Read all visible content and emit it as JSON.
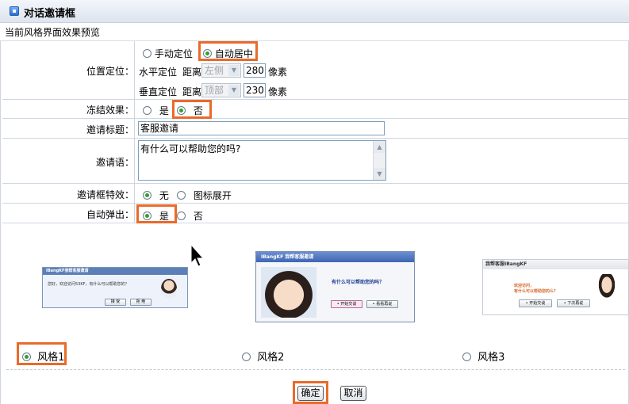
{
  "dialog": {
    "title": "对话邀请框",
    "subtitle": "当前风格界面效果预览"
  },
  "position": {
    "label": "位置定位：",
    "opt_manual": "手动定位",
    "opt_auto": "自动居中",
    "h_label": "水平定位",
    "h_dist": "距离",
    "h_select": "左侧",
    "h_value": "280",
    "h_unit": "像素",
    "v_label": "垂直定位",
    "v_dist": "距离",
    "v_select": "顶部",
    "v_value": "230",
    "v_unit": "像素"
  },
  "freeze": {
    "label": "冻结效果：",
    "opt_yes": "是",
    "opt_no": "否"
  },
  "invite_title": {
    "label": "邀请标题：",
    "value": "客服邀请"
  },
  "invite_text": {
    "label": "邀请语：",
    "value": "有什么可以帮助您的吗?"
  },
  "effect": {
    "label": "邀请框特效：",
    "opt_none": "无",
    "opt_expand": "图标展开"
  },
  "autopop": {
    "label": "自动弹出：",
    "opt_yes": "是",
    "opt_no": "否"
  },
  "styles": {
    "style1": {
      "label": "风格1",
      "header": "IBangKF我帮客服邀请",
      "msg": "您好，欢迎访问53KF，有什么可以帮助您的？",
      "btn_accept": "接 受",
      "btn_reject": "拒 绝"
    },
    "style2": {
      "label": "风格2",
      "header": "IBangKF 我帮客服邀请",
      "msg": "有什么可以帮助您的吗？",
      "btn_start": "• 开始交谈",
      "btn_later": "• 看看再说"
    },
    "style3": {
      "label": "风格3",
      "header": "我帮客服IBangKF",
      "msg1": "欢迎访问，",
      "msg2": "有什么可以帮助您的么？",
      "btn_start": "• 开始交谈",
      "btn_later": "• 下次再说"
    }
  },
  "buttons": {
    "ok": "确定",
    "cancel": "取消"
  },
  "colors": {
    "accent_highlight": "#ea6a2a",
    "radio_on": "#2aa52a",
    "title_bg": "#e4eaf2"
  }
}
